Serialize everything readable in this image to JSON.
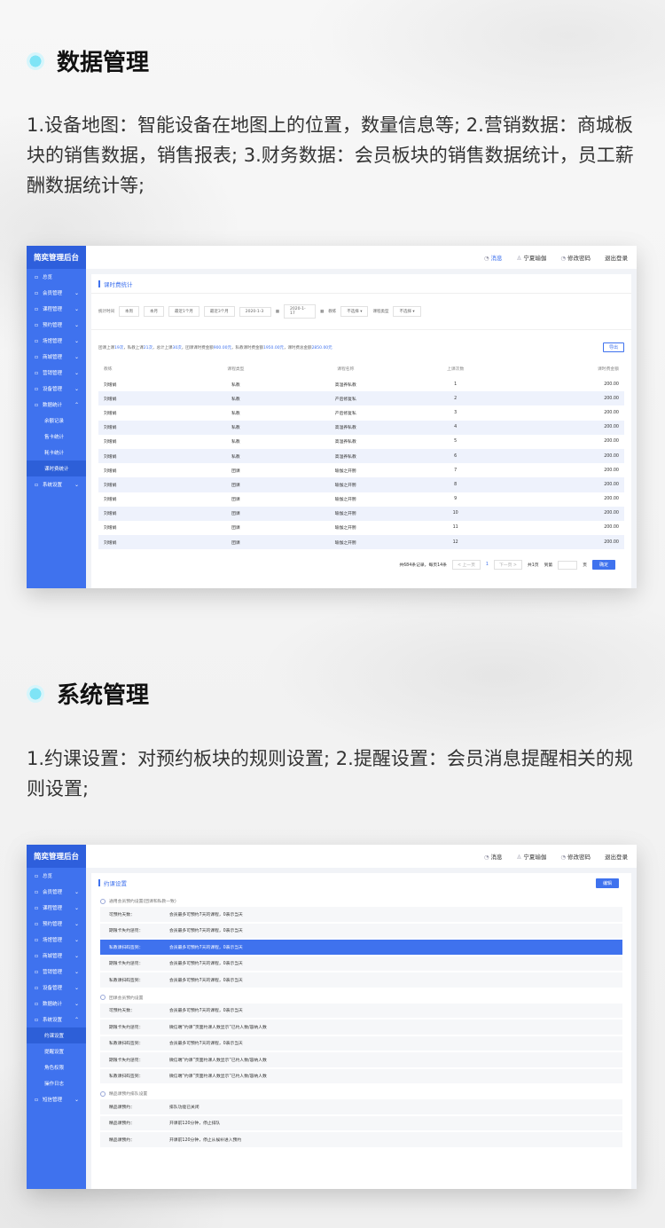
{
  "section1": {
    "title": "数据管理",
    "desc": "1.设备地图：智能设备在地图上的位置，数量信息等; 2.营销数据：商城板块的销售数据，销售报表; 3.财务数据：会员板块的销售数据统计，员工薪酬数据统计等;"
  },
  "section2": {
    "title": "系统管理",
    "desc": "1.约课设置：对预约板块的规则设置; 2.提醒设置：会员消息提醒相关的规则设置;"
  },
  "app1": {
    "brand": "简奕管理后台",
    "top": {
      "msg": "消息",
      "user": "宁夏瑜伽",
      "pwd": "修改密码",
      "logout": "退出登录"
    },
    "menu": [
      {
        "label": "总览",
        "chev": ""
      },
      {
        "label": "会员管理",
        "chev": "⌄"
      },
      {
        "label": "课程管理",
        "chev": "⌄"
      },
      {
        "label": "预约管理",
        "chev": "⌄"
      },
      {
        "label": "场馆管理",
        "chev": "⌄"
      },
      {
        "label": "商城管理",
        "chev": "⌄"
      },
      {
        "label": "营销管理",
        "chev": "⌄"
      },
      {
        "label": "设备管理",
        "chev": "⌄"
      },
      {
        "label": "数据统计",
        "chev": "⌃"
      },
      {
        "label": "余额记录",
        "chev": ""
      },
      {
        "label": "售卡统计",
        "chev": ""
      },
      {
        "label": "耗卡统计",
        "chev": ""
      },
      {
        "label": "课时费统计",
        "chev": ""
      },
      {
        "label": "系统设置",
        "chev": "⌄"
      }
    ],
    "panel_title": "课时费统计",
    "filters": {
      "label1": "统计时间",
      "b1": "本周",
      "b2": "本月",
      "b3": "最近1个月",
      "b4": "最近3个月",
      "date1": "2020-1-3",
      "date2": "2020-1-17",
      "label2": "教练",
      "sel1": "不选择",
      "label3": "课程类型",
      "sel2": "不选择"
    },
    "summary": {
      "p1": "团课上课",
      "v1": "19次",
      "p2": "，私教上课",
      "v2": "21次",
      "p3": "，总计上课",
      "v3": "30次",
      "p4": "，团课课时费金额",
      "v4": "900.00元",
      "p5": "，私教课时费金额",
      "v5": "1950.00元",
      "p6": "，课时费总金额",
      "v6": "2850.00元",
      "export": "导出"
    },
    "table": {
      "headers": [
        "教练",
        "课程类型",
        "课程名称",
        "上课次数",
        "课时费金额"
      ],
      "rows": [
        [
          "刘增娟",
          "私教",
          "高温养私教",
          "1",
          "200.00"
        ],
        [
          "刘增娟",
          "私教",
          "产后修复私",
          "2",
          "200.00"
        ],
        [
          "刘增娟",
          "私教",
          "产后修复私",
          "3",
          "200.00"
        ],
        [
          "刘增娟",
          "私教",
          "高温养私教",
          "4",
          "200.00"
        ],
        [
          "刘增娟",
          "私教",
          "高温养私教",
          "5",
          "200.00"
        ],
        [
          "刘增娟",
          "私教",
          "高温养私教",
          "6",
          "200.00"
        ],
        [
          "刘增娟",
          "团课",
          "瑜伽之开胯",
          "7",
          "200.00"
        ],
        [
          "刘增娟",
          "团课",
          "瑜伽之开胯",
          "8",
          "200.00"
        ],
        [
          "刘增娟",
          "团课",
          "瑜伽之开胯",
          "9",
          "200.00"
        ],
        [
          "刘增娟",
          "团课",
          "瑜伽之开胯",
          "10",
          "200.00"
        ],
        [
          "刘增娟",
          "团课",
          "瑜伽之开胯",
          "11",
          "200.00"
        ],
        [
          "刘增娟",
          "团课",
          "瑜伽之开胯",
          "12",
          "200.00"
        ]
      ]
    },
    "pager": {
      "total": "共684条记录，每页14条",
      "prev": "< 上一页",
      "page": "1",
      "next": "下一页 >",
      "pages": "共1页",
      "goto": "到第",
      "unit": "页",
      "ok": "确定"
    }
  },
  "app2": {
    "brand": "简奕管理后台",
    "top": {
      "msg": "消息",
      "user": "宁夏瑜伽",
      "pwd": "修改密码",
      "logout": "退出登录"
    },
    "menu": [
      {
        "label": "总览",
        "chev": ""
      },
      {
        "label": "会员管理",
        "chev": "⌄"
      },
      {
        "label": "课程管理",
        "chev": "⌄"
      },
      {
        "label": "预约管理",
        "chev": "⌄"
      },
      {
        "label": "场馆管理",
        "chev": "⌄"
      },
      {
        "label": "商城管理",
        "chev": "⌄"
      },
      {
        "label": "营销管理",
        "chev": "⌄"
      },
      {
        "label": "设备管理",
        "chev": "⌄"
      },
      {
        "label": "数据统计",
        "chev": "⌄"
      },
      {
        "label": "系统设置",
        "chev": "⌃"
      },
      {
        "label": "约课设置",
        "chev": ""
      },
      {
        "label": "提醒设置",
        "chev": ""
      },
      {
        "label": "角色权限",
        "chev": ""
      },
      {
        "label": "操作日志",
        "chev": ""
      },
      {
        "label": "短信管理",
        "chev": "⌄"
      }
    ],
    "panel_title": "约课设置",
    "edit": "编辑",
    "groups": [
      {
        "title": "通用会员预约设置(团课和私教一致)",
        "rows": [
          [
            "可预约天数：",
            "会员最多可预约7天的课程，0表示当天"
          ],
          [
            "期限卡失约惩罚：",
            "会员最多可预约7天的课程，0表示当天"
          ],
          [
            "私教课扫码签到：",
            "会员最多可预约7天的课程，0表示当天"
          ],
          [
            "期限卡失约惩罚：",
            "会员最多可预约7天的课程，0表示当天"
          ],
          [
            "私教课扫码签到：",
            "会员最多可预约7天的课程，0表示当天"
          ]
        ]
      },
      {
        "title": "团课会员预约设置",
        "rows": [
          [
            "可预约天数：",
            "会员最多可预约7天的课程，0表示当天"
          ],
          [
            "期限卡失约惩罚：",
            "微信端“约课”页面约课人数显示“已约人数/容纳人数"
          ],
          [
            "私教课扫码签到：",
            "会员最多可预约7天的课程，0表示当天"
          ],
          [
            "期限卡失约惩罚：",
            "微信端“约课”页面约课人数显示“已约人数/容纳人数"
          ],
          [
            "私教课扫码签到：",
            "微信端“约课”页面约课人数显示“已约人数/容纳人数"
          ]
        ]
      },
      {
        "title": "精品课预约排队设置",
        "rows": [
          [
            "精品课预约：",
            "排队功能已关闭"
          ],
          [
            "精品课预约：",
            "开课前120分钟，停止排队"
          ],
          [
            "精品课预约：",
            "开课前120分钟，停止从候补进入预约"
          ]
        ]
      }
    ]
  }
}
